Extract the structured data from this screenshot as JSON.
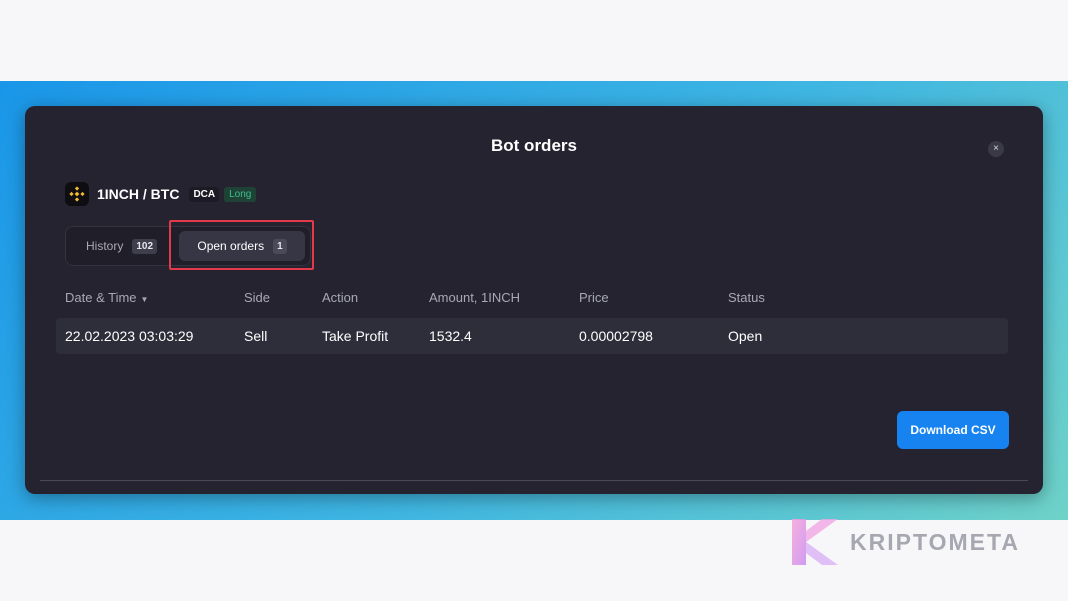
{
  "modal": {
    "title": "Bot orders",
    "close_symbol": "×"
  },
  "bot": {
    "pair": "1INCH / BTC",
    "strategy_badge": "DCA",
    "direction_badge": "Long",
    "exchange_icon": "binance-icon"
  },
  "tabs": [
    {
      "label": "History",
      "count": "102",
      "active": false
    },
    {
      "label": "Open orders",
      "count": "1",
      "active": true
    }
  ],
  "table": {
    "columns": [
      "Date & Time",
      "Side",
      "Action",
      "Amount, 1INCH",
      "Price",
      "Status"
    ],
    "rows": [
      {
        "datetime": "22.02.2023 03:03:29",
        "side": "Sell",
        "action": "Take Profit",
        "amount": "1532.4",
        "price": "0.00002798",
        "status": "Open"
      }
    ]
  },
  "actions": {
    "download_label": "Download CSV"
  },
  "watermark": {
    "text": "KRIPTOMETA"
  },
  "colors": {
    "accent": "#1683f0",
    "long_badge": "#3fbf8a",
    "highlight": "#e23a4a",
    "modal_bg": "#24232f"
  }
}
